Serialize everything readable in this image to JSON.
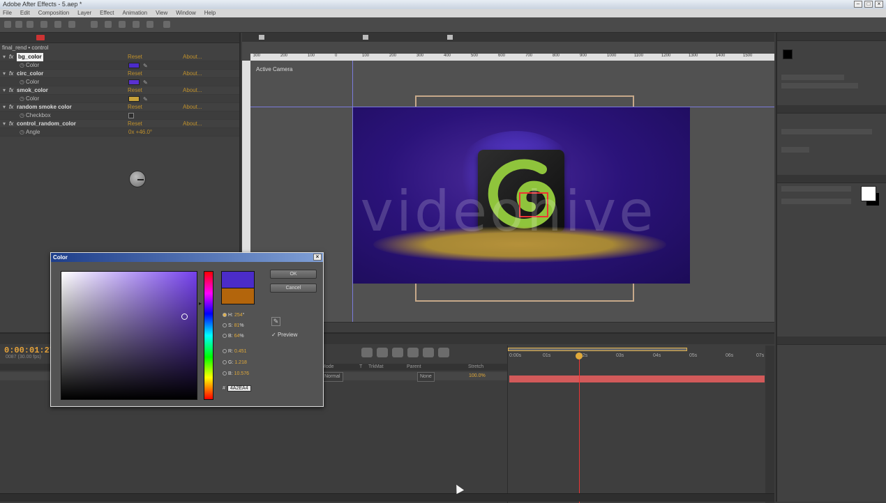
{
  "window": {
    "title": "Adobe After Effects - 5.aep *",
    "controls": [
      "–",
      "□",
      "×"
    ]
  },
  "menubar": [
    "File",
    "Edit",
    "Composition",
    "Layer",
    "Effect",
    "Animation",
    "View",
    "Window",
    "Help"
  ],
  "effect_controls": {
    "breadcrumb": "final_rend • control",
    "effects": [
      {
        "name": "bg_color",
        "reset": "Reset",
        "about": "About...",
        "param": "Color",
        "swatch": "#4b2cc9"
      },
      {
        "name": "circ_color",
        "reset": "Reset",
        "about": "About...",
        "param": "Color",
        "swatch": "#5a31d0"
      },
      {
        "name": "smok_color",
        "reset": "Reset",
        "about": "About...",
        "param": "Color",
        "swatch": "#c9a33a"
      },
      {
        "name": "random smoke color",
        "reset": "Reset",
        "about": "About...",
        "param": "Checkbox"
      },
      {
        "name": "control_random_color",
        "reset": "Reset",
        "about": "About...",
        "param": "Angle",
        "value": "0x +46.0°"
      }
    ]
  },
  "composition": {
    "viewer_label": "Active Camera",
    "watermark": "videohive",
    "ruler_ticks": [
      "300",
      "200",
      "100",
      "0",
      "100",
      "200",
      "300",
      "400",
      "500",
      "600",
      "700",
      "800",
      "900",
      "1000",
      "1100",
      "1200",
      "1300",
      "1400",
      "1500"
    ]
  },
  "color_dialog": {
    "title": "Color",
    "close": "×",
    "ok_label": "OK",
    "cancel_label": "Cancel",
    "preview_label": "Preview",
    "preview_check": "✓",
    "new_color": "#4b2cc9",
    "old_color": "#b3650c",
    "fields": [
      {
        "label": "H:",
        "value": "254",
        "unit": "°",
        "selected": true
      },
      {
        "label": "S:",
        "value": "81",
        "unit": "%",
        "selected": false
      },
      {
        "label": "B:",
        "value": "64",
        "unit": "%",
        "selected": false
      },
      {
        "label": "R:",
        "value": "0.451",
        "unit": "",
        "selected": false
      },
      {
        "label": "G:",
        "value": "1.218",
        "unit": "",
        "selected": false
      },
      {
        "label": "B:",
        "value": "10.576",
        "unit": "",
        "selected": false
      }
    ],
    "hex_label": "#",
    "hex_value": "4A2EA4"
  },
  "timeline": {
    "timecode": "0:00:01:27",
    "frames": "0087 (30.00 fps)",
    "columns": [
      "Mode",
      "T",
      "TrkMat",
      "Parent",
      "Stretch"
    ],
    "layer": {
      "mode": "Normal",
      "parent": "None",
      "stretch": "100.0%"
    },
    "ruler": [
      "0:00s",
      "01s",
      "02s",
      "03s",
      "04s",
      "05s",
      "06s",
      "07s"
    ]
  },
  "colors": {
    "accent_orange": "#e0a93a",
    "layer_bar": "#d25a5a",
    "playhead": "#ee3333"
  }
}
